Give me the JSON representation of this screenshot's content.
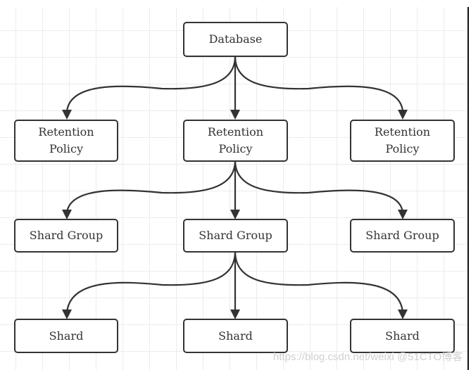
{
  "diagram": {
    "nodes": {
      "database": {
        "label": "Database"
      },
      "rp_left": {
        "label_line1": "Retention",
        "label_line2": "Policy"
      },
      "rp_center": {
        "label_line1": "Retention",
        "label_line2": "Policy"
      },
      "rp_right": {
        "label_line1": "Retention",
        "label_line2": "Policy"
      },
      "sg_left": {
        "label": "Shard Group"
      },
      "sg_center": {
        "label": "Shard Group"
      },
      "sg_right": {
        "label": "Shard Group"
      },
      "shard_left": {
        "label": "Shard"
      },
      "shard_center": {
        "label": "Shard"
      },
      "shard_right": {
        "label": "Shard"
      }
    },
    "edges": [
      {
        "from": "database",
        "to": "rp_left"
      },
      {
        "from": "database",
        "to": "rp_center"
      },
      {
        "from": "database",
        "to": "rp_right"
      },
      {
        "from": "rp_center",
        "to": "sg_left"
      },
      {
        "from": "rp_center",
        "to": "sg_center"
      },
      {
        "from": "rp_center",
        "to": "sg_right"
      },
      {
        "from": "sg_center",
        "to": "shard_left"
      },
      {
        "from": "sg_center",
        "to": "shard_center"
      },
      {
        "from": "sg_center",
        "to": "shard_right"
      }
    ],
    "colors": {
      "stroke": "#333333",
      "grid": "#ececec",
      "background": "#ffffff"
    }
  },
  "watermark": "https://blog.csdn.net/weixi @51CTO博客"
}
